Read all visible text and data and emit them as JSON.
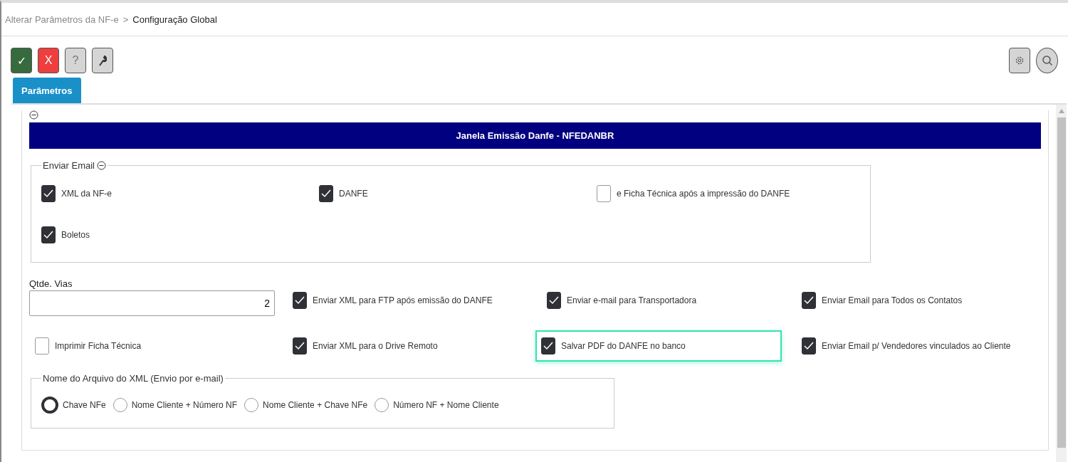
{
  "breadcrumb": {
    "parent": "Alterar Parâmetros da NF-e",
    "separator": ">",
    "current": "Configuração Global"
  },
  "toolbar": [
    {
      "kind": "confirm",
      "label": "✓"
    },
    {
      "kind": "cancel",
      "label": "X"
    },
    {
      "kind": "help",
      "label": "?"
    },
    {
      "kind": "tool"
    }
  ],
  "tabs": [
    {
      "label": "Parâmetros",
      "selected": true
    }
  ],
  "section": {
    "expanded": true,
    "title": "Janela Emissão Danfe - NFEDANBR"
  },
  "email_group": {
    "legend": "Enviar Email",
    "expanded": true,
    "items": [
      {
        "label": "XML da NF-e",
        "checked": true
      },
      {
        "label": "DANFE",
        "checked": true
      },
      {
        "label": "e Ficha Técnica após a impressão do DANFE",
        "checked": false
      },
      {
        "label": "Boletos",
        "checked": true
      }
    ]
  },
  "copies": {
    "label": "Qtde. Vias",
    "value": "2"
  },
  "options": [
    {
      "label": "Enviar XML para FTP após emissão do DANFE",
      "checked": true,
      "focused": false
    },
    {
      "label": "Enviar e-mail para Transportadora",
      "checked": true,
      "focused": false
    },
    {
      "label": "Enviar Email para Todos os Contatos",
      "checked": true,
      "focused": false
    },
    {
      "label": "Imprimir Ficha Técnica",
      "checked": false,
      "focused": false
    },
    {
      "label": "Enviar XML para o Drive Remoto",
      "checked": true,
      "focused": false
    },
    {
      "label": "Salvar PDF do DANFE no banco",
      "checked": true,
      "focused": true
    },
    {
      "label": "Enviar Email p/ Vendedores vinculados ao Cliente",
      "checked": true,
      "focused": false
    }
  ],
  "file_name_group": {
    "legend": "Nome do Arquivo do XML (Envio por e-mail)",
    "options": [
      {
        "label": "Chave NFe",
        "selected": true
      },
      {
        "label": "Nome Cliente + Número NF",
        "selected": false
      },
      {
        "label": "Nome Cliente + Chave NFe",
        "selected": false
      },
      {
        "label": "Número NF + Nome Cliente",
        "selected": false
      }
    ]
  }
}
